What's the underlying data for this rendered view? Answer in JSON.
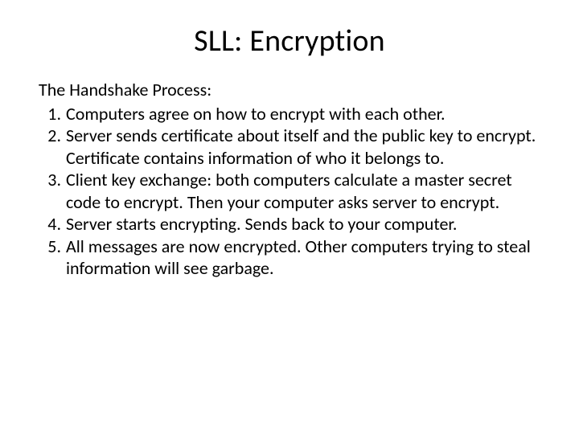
{
  "title": "SLL: Encryption",
  "subtitle": "The Handshake Process:",
  "items": [
    "Computers agree on how to encrypt with each other.",
    "Server sends certificate about itself and the public key to encrypt. Certificate contains information of who it belongs to.",
    "Client key exchange: both computers calculate a master secret code to encrypt. Then your computer asks server to encrypt.",
    "Server starts encrypting. Sends back to your computer.",
    "All messages are now encrypted. Other computers trying to steal information will see garbage."
  ]
}
